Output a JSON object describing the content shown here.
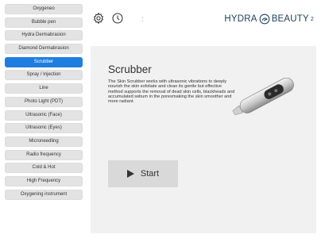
{
  "sidebar": {
    "items": [
      {
        "label": "Oxygeneo"
      },
      {
        "label": "Bubble pen"
      },
      {
        "label": "Hydra Dermabrasion"
      },
      {
        "label": "Diamond Dermabrasion"
      },
      {
        "label": "Scrubber",
        "active": true
      },
      {
        "label": "Spray / Injection"
      },
      {
        "label": "Line"
      },
      {
        "label": "Photo Light (PDT)"
      },
      {
        "label": "Ultrasonic (Face)"
      },
      {
        "label": "Ultrasonic (Eyes)"
      },
      {
        "label": "Microneedling"
      },
      {
        "label": "Radio frequency"
      },
      {
        "label": "Cold & Hot"
      },
      {
        "label": "High Frequency"
      },
      {
        "label": "Oxygening instrument"
      }
    ]
  },
  "header": {
    "brand_left": "HYDRA",
    "brand_right": "BEAUTY",
    "brand_sup": "2",
    "icons": [
      "gear-icon",
      "clock-icon",
      "more-icon"
    ]
  },
  "main": {
    "title": "Scrubber",
    "description": "The Skin Scrubber works with ultrasonic vibrations to deeply nourish the skin exfoliate and clean its gentle but effective method supports the removal of dead skin cells, blackheads and accumulated sebum in the poresmaking the skin smoother and more radiant.",
    "start_label": "Start"
  },
  "colors": {
    "accent": "#1e7ee0",
    "brand": "#1c3d57",
    "panel_bg": "#f1f1f1",
    "button_bg": "#d9d9d9",
    "sidebar_item_bg": "#e3e3e3"
  }
}
